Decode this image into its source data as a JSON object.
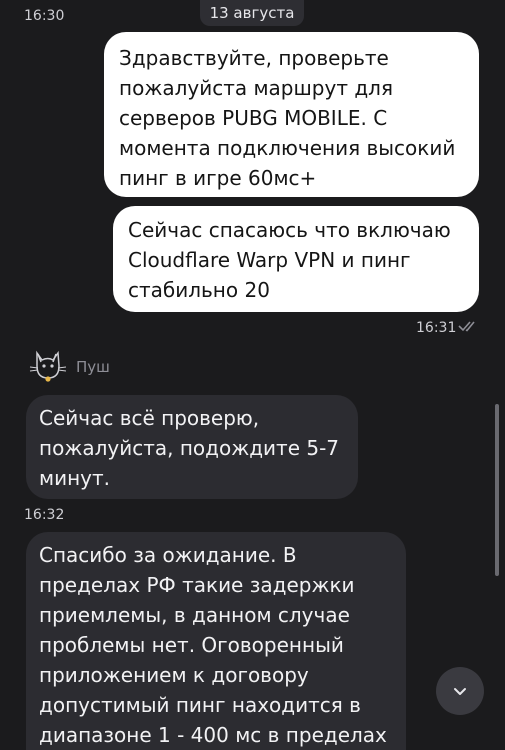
{
  "header": {
    "time_left": "16:30",
    "date": "13 августа"
  },
  "messages": [
    {
      "side": "out",
      "text": "Здравствуйте, проверьте\nпожалуйста маршрут для\nсерверов PUBG MOBILE. С\nмомента подключения высокий\nпинг в игре 60мс+"
    },
    {
      "side": "out",
      "text": "Сейчас спасаюсь что включаю\nCloudflare Warp VPN и пинг\nстабильно 20",
      "time": "16:31",
      "status": "read"
    },
    {
      "side": "in",
      "sender": "Пуш",
      "text": "Сейчас всё проверю,\nпожалуйста, подождите 5-7\nминут.",
      "time": "16:32"
    },
    {
      "side": "in",
      "text": "Спасибо за ожидание. В\nпределах РФ такие задержки\nприемлемы, в данном случае\nпроблемы нет.  Оговоренный\nприложением к договору\nдопустимый пинг находится в\nдиапазоне 1 - 400 мс в пределах"
    }
  ],
  "icons": {
    "read_receipt": "double-check-icon",
    "avatar": "cat-avatar-icon",
    "scroll_down": "chevron-down-icon"
  },
  "colors": {
    "background": "#1b1b1d",
    "outgoing_bubble": "#ffffff",
    "incoming_bubble": "#2c2c31"
  }
}
